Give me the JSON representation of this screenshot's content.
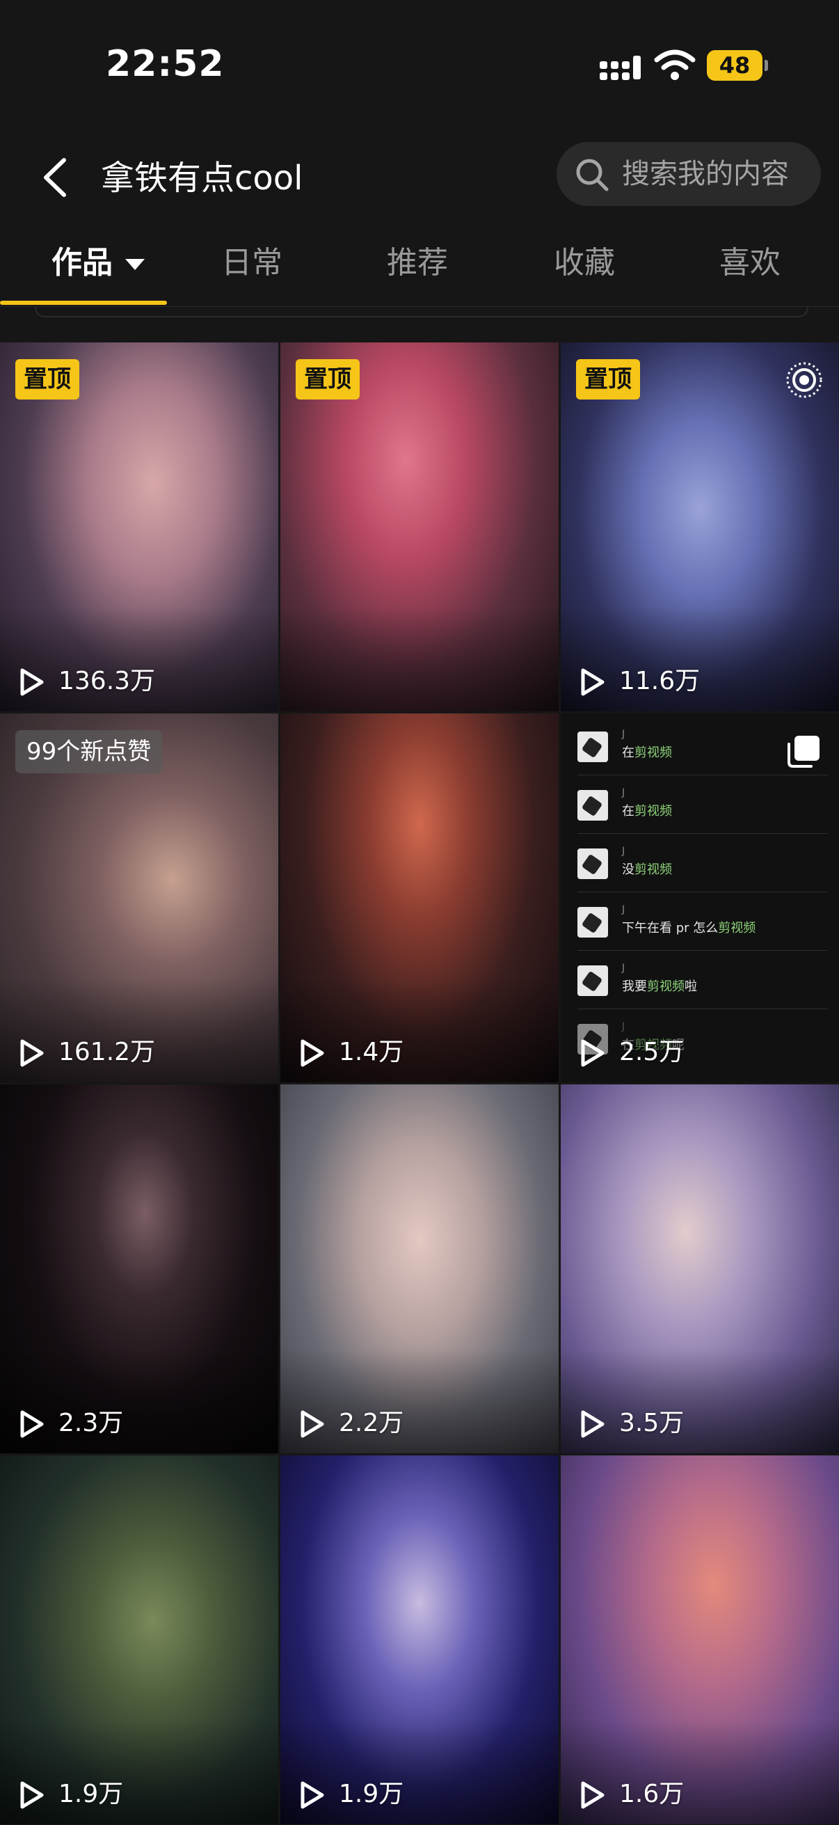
{
  "status_bar": {
    "time": "22:52",
    "battery": "48"
  },
  "header": {
    "title": "拿铁有点cool",
    "search_placeholder": "搜索我的内容"
  },
  "tabs": [
    {
      "label": "作品",
      "active": true
    },
    {
      "label": "日常",
      "active": false
    },
    {
      "label": "推荐",
      "active": false
    },
    {
      "label": "收藏",
      "active": false
    },
    {
      "label": "喜欢",
      "active": false
    }
  ],
  "colors": {
    "accent": "#f5c518",
    "background": "#161616",
    "comment_highlight": "#8ed47a"
  },
  "videos": [
    {
      "badge": "置顶",
      "plays": "136.3万"
    },
    {
      "badge": "置顶",
      "plays": ""
    },
    {
      "badge": "置顶",
      "plays": "11.6万",
      "corner_icon": "live-photo-icon"
    },
    {
      "badge": "99个新点赞",
      "plays": "161.2万"
    },
    {
      "badge": "",
      "plays": "1.4万"
    },
    {
      "badge": "",
      "plays": "2.5万",
      "corner_icon": "multi-image-icon"
    },
    {
      "badge": "",
      "plays": "2.3万"
    },
    {
      "badge": "",
      "plays": "2.2万"
    },
    {
      "badge": "",
      "plays": "3.5万"
    },
    {
      "badge": "",
      "plays": "1.9万"
    },
    {
      "badge": "",
      "plays": "1.9万"
    },
    {
      "badge": "",
      "plays": "1.6万"
    }
  ],
  "comment_tile": [
    {
      "j": "J",
      "before": "在",
      "highlight": "剪视频",
      "after": ""
    },
    {
      "j": "J",
      "before": "在",
      "highlight": "剪视频",
      "after": ""
    },
    {
      "j": "J",
      "before": "没",
      "highlight": "剪视频",
      "after": ""
    },
    {
      "j": "J",
      "before": "下午在看 pr 怎么",
      "highlight": "剪视频",
      "after": ""
    },
    {
      "j": "J",
      "before": "我要",
      "highlight": "剪视频",
      "after": "啦"
    },
    {
      "j": "J",
      "before": "在",
      "highlight": "剪视频",
      "after": "呢"
    }
  ]
}
